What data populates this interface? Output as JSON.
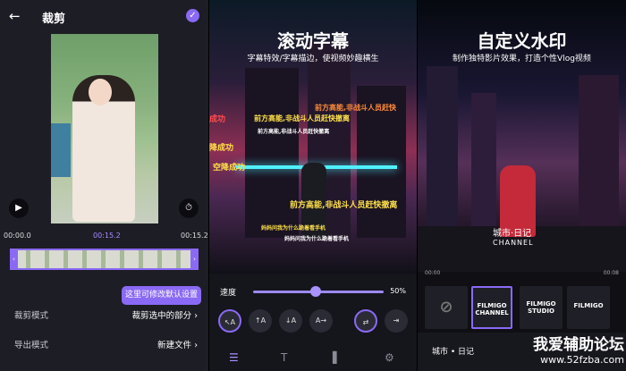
{
  "panel1": {
    "title": "裁剪",
    "time_start": "00:00.0",
    "time_mid": "00:15.2",
    "time_end": "00:15.2",
    "tooltip": "这里可修改默认设置",
    "rows": [
      {
        "label": "裁剪模式",
        "value": "裁剪选中的部分"
      },
      {
        "label": "导出模式",
        "value": "新建文件"
      }
    ],
    "accent": "#8a6af5"
  },
  "panel2": {
    "title": "滚动字幕",
    "subtitle": "字幕特效/字幕描边，使视频妙趣横生",
    "captions": [
      "前方高能,非战斗人员赶快",
      "前方高能,非战斗人员赶快撤离",
      "前方高能,非战斗人员赶快撤离",
      "成功",
      "降成功",
      "空降成功",
      "前方高能,非战斗人员赶快撤离",
      "妈妈问我为什么跪着看手机",
      "妈妈问我为什么跪着看手机"
    ],
    "speed_label": "速度",
    "speed_value": "50%",
    "speed": 0.5,
    "buttons": [
      "↖A",
      "↑A",
      "↓A",
      "A→"
    ],
    "tabs": [
      "slider-icon",
      "text-icon",
      "panel-icon",
      "gear-icon"
    ]
  },
  "panel3": {
    "title": "自定义水印",
    "subtitle": "制作独特影片效果，打造个性Vlog视频",
    "watermark_line1": "城市·日记",
    "watermark_line2": "CHANNEL",
    "time_start": "00:00",
    "time_end": "00:08",
    "tiles": [
      "FILMIGO CHANNEL",
      "FILMIGO STUDIO",
      "FILMIGO"
    ],
    "input_value": "城市 • 日记"
  },
  "footer": {
    "brand": "我爱辅助论坛",
    "url": "www.52fzba.com"
  }
}
